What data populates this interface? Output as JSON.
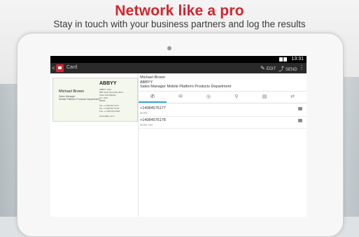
{
  "promo": {
    "headline": "Network like a pro",
    "subline": "Stay in touch with your business partners and log the results"
  },
  "status_bar": {
    "time": "13:31"
  },
  "action_bar": {
    "back_glyph": "<",
    "title": "Card",
    "edit_label": "EDIT",
    "send_label": "SEND",
    "more_glyph": "⋮"
  },
  "card_image": {
    "name": "Michael Brown",
    "title_lines": [
      "Sales Manager",
      "Mobile Platform Products Department"
    ],
    "company_logo": "ABBYY",
    "right_lines": [
      "ABBYY USA",
      "880 North McCarthy Blvd.",
      "Suite 220 Milpitas",
      "CA, USA",
      "95035",
      "Tel: +1 408 457 6177",
      "Tel: +1 408 457 6178",
      "Fax: +1 408 434 0300",
      "www.abbyy.com"
    ]
  },
  "contact": {
    "name": "Michael Brown",
    "company": "ABBYY",
    "position": "Sales Manager Mobile Platform Products Department"
  },
  "tabs": [
    {
      "icon": "phone-icon",
      "glyph": "✆",
      "active": true
    },
    {
      "icon": "email-icon",
      "glyph": "✉",
      "active": false
    },
    {
      "icon": "web-icon",
      "glyph": "◎",
      "active": false
    },
    {
      "icon": "location-icon",
      "glyph": "⚲",
      "active": false
    },
    {
      "icon": "notes-icon",
      "glyph": "▤",
      "active": false
    },
    {
      "icon": "connections-icon",
      "glyph": "⇄",
      "active": false
    }
  ],
  "phones": [
    {
      "number": "+14084576177",
      "label": "WORK"
    },
    {
      "number": "+14084576178",
      "label": "WORK FAX"
    }
  ]
}
